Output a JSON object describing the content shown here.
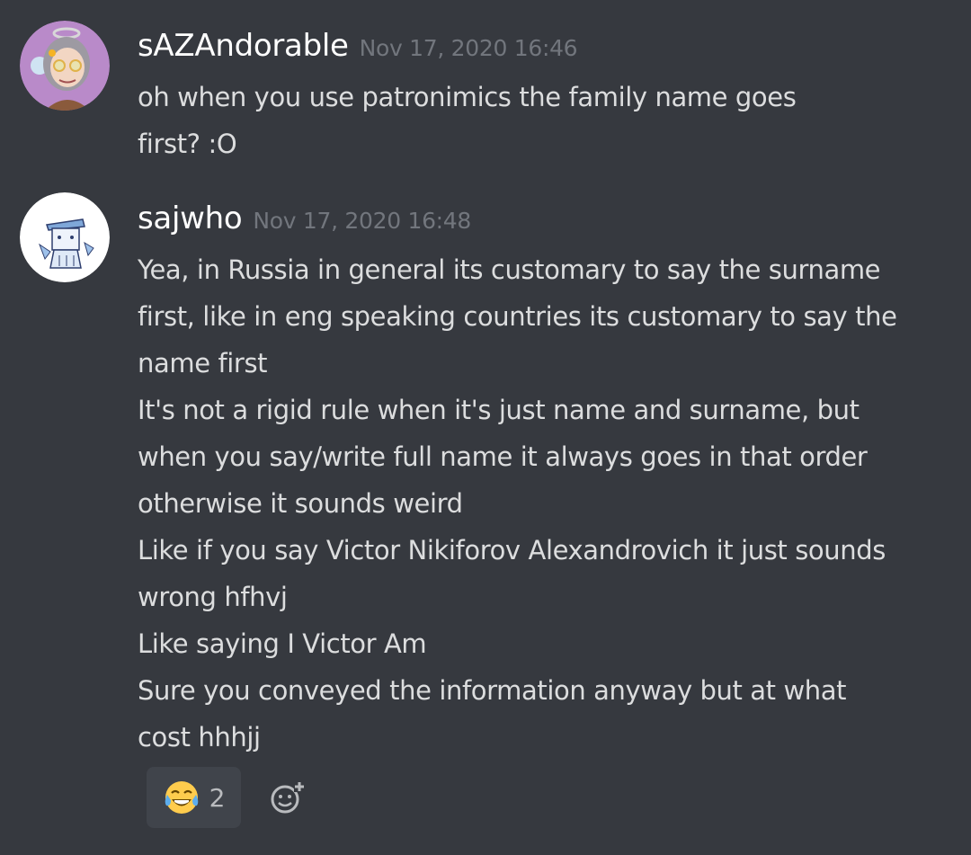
{
  "messages": [
    {
      "username": "sAZAndorable",
      "timestamp": "Nov 17, 2020 16:46",
      "avatar_icon": "avatar-anime-girl-icon",
      "lines": [
        "oh when you use patronimics the family name goes",
        "first? :O"
      ]
    },
    {
      "username": "sajwho",
      "timestamp": "Nov 17, 2020 16:48",
      "avatar_icon": "avatar-sketch-character-icon",
      "lines": [
        "Yea, in Russia in general its customary to say the surname",
        "first, like in eng speaking countries its customary to say the",
        "name first",
        "It's not a rigid rule when it's just name and surname, but",
        "when you say/write full name it always goes in that order",
        "otherwise it sounds weird",
        "Like if you say Victor Nikiforov Alexandrovich it just sounds",
        "wrong hfhvj",
        "Like saying I Victor Am",
        "Sure you conveyed the information anyway but at what",
        "cost hhhjj"
      ],
      "reactions": [
        {
          "emoji_icon": "tears-of-joy-emoji-icon",
          "count": "2"
        }
      ]
    }
  ],
  "colors": {
    "background": "#36393f",
    "username": "#ffffff",
    "timestamp": "#72767d",
    "text": "#dcddde",
    "reaction_bg": "#40444b"
  }
}
